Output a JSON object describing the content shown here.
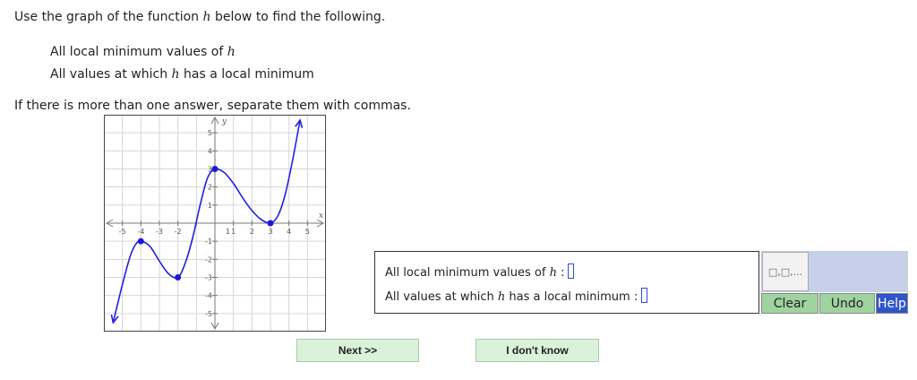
{
  "prompt": {
    "intro_before": "Use the graph of the function ",
    "func": "h",
    "intro_after": " below to find the following."
  },
  "items": [
    {
      "before": "All local minimum values of ",
      "var": "h",
      "after": ""
    },
    {
      "before": "All values at which ",
      "var": "h",
      "after": " has a local minimum"
    }
  ],
  "separator_note": "If there is more than one answer, separate them with commas.",
  "graph": {
    "x_label": "x",
    "y_label": "y",
    "x_ticks": [
      "-5",
      "-4",
      "-3",
      "-2",
      "1",
      "1",
      "2",
      "3",
      "4",
      "5"
    ],
    "y_ticks": [
      "5",
      "4",
      "3",
      "2",
      "1",
      "-1",
      "-2",
      "-3",
      "-4",
      "-5"
    ]
  },
  "chart_data": {
    "type": "line",
    "title": "",
    "xlabel": "x",
    "ylabel": "y",
    "xlim": [
      -6,
      6
    ],
    "ylim": [
      -6,
      6
    ],
    "grid": true,
    "key_points": [
      {
        "x": -4,
        "y": -1
      },
      {
        "x": -2,
        "y": -3
      },
      {
        "x": 0,
        "y": 3
      },
      {
        "x": 3,
        "y": 0
      }
    ],
    "curve": [
      {
        "x": -5.5,
        "y": -5.5
      },
      {
        "x": -5,
        "y": -3.4
      },
      {
        "x": -4.6,
        "y": -1.9
      },
      {
        "x": -4.3,
        "y": -1.2
      },
      {
        "x": -4,
        "y": -1
      },
      {
        "x": -3.5,
        "y": -1.3
      },
      {
        "x": -3,
        "y": -2.1
      },
      {
        "x": -2.5,
        "y": -2.8
      },
      {
        "x": -2,
        "y": -3
      },
      {
        "x": -1.6,
        "y": -2.2
      },
      {
        "x": -1.2,
        "y": -0.8
      },
      {
        "x": -0.8,
        "y": 1
      },
      {
        "x": -0.4,
        "y": 2.5
      },
      {
        "x": 0,
        "y": 3
      },
      {
        "x": 0.5,
        "y": 2.8
      },
      {
        "x": 1,
        "y": 2.2
      },
      {
        "x": 1.5,
        "y": 1.4
      },
      {
        "x": 2,
        "y": 0.7
      },
      {
        "x": 2.5,
        "y": 0.2
      },
      {
        "x": 3,
        "y": 0
      },
      {
        "x": 3.4,
        "y": 0.4
      },
      {
        "x": 3.8,
        "y": 1.6
      },
      {
        "x": 4.2,
        "y": 3.5
      },
      {
        "x": 4.6,
        "y": 5.7
      }
    ]
  },
  "answers": {
    "row1_before": "All local minimum values of ",
    "row1_var": "h",
    "row1_after": " :",
    "row2_before": "All values at which ",
    "row2_var": "h",
    "row2_after": " has a local minimum  :"
  },
  "tools": {
    "template_label": "□,□,...",
    "clear": "Clear",
    "undo": "Undo",
    "help": "Help"
  },
  "nav": {
    "next": "Next >>",
    "idk": "I don't know"
  }
}
